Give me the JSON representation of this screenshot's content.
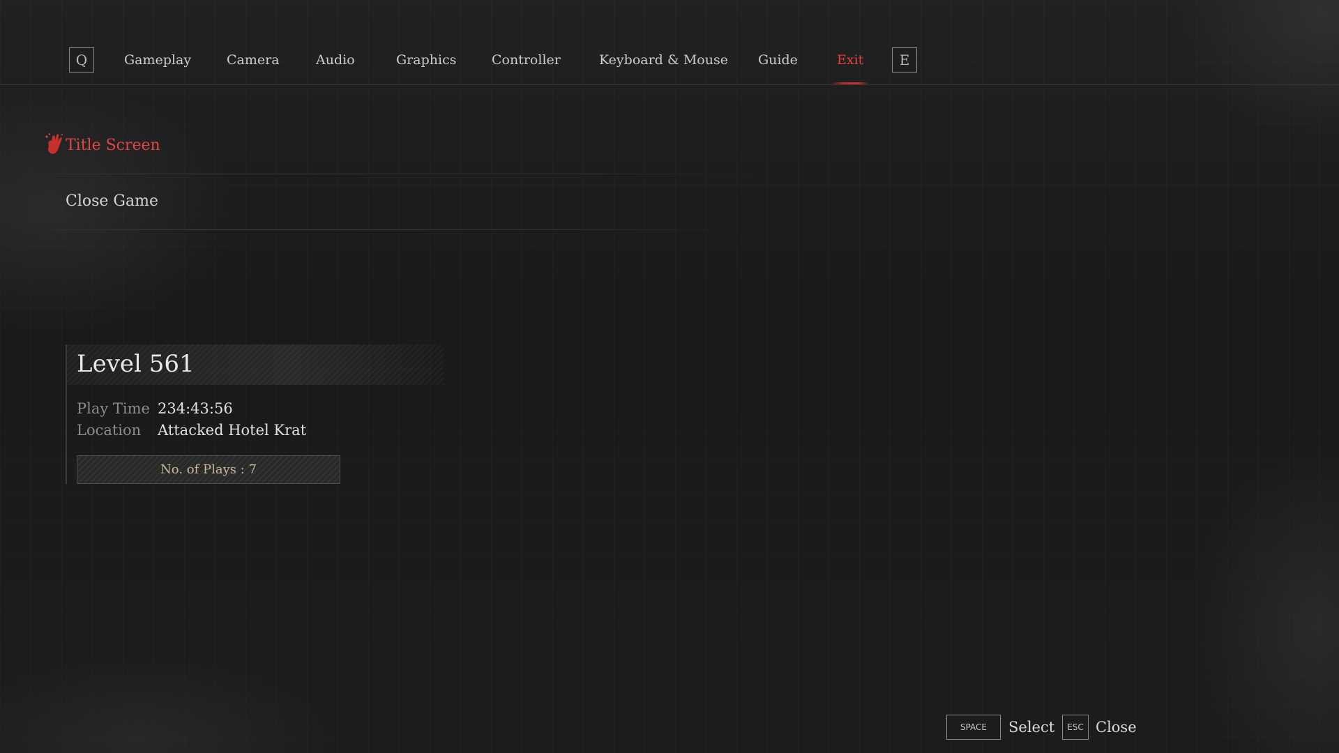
{
  "nav": {
    "prev_key": "Q",
    "next_key": "E",
    "tabs": [
      {
        "label": "Gameplay"
      },
      {
        "label": "Camera"
      },
      {
        "label": "Audio"
      },
      {
        "label": "Graphics"
      },
      {
        "label": "Controller"
      },
      {
        "label": "Keyboard & Mouse"
      },
      {
        "label": "Guide"
      },
      {
        "label": "Exit"
      }
    ],
    "active_tab": "Exit"
  },
  "exit_menu": {
    "items": [
      {
        "label": "Title Screen",
        "selected": true,
        "icon": "hand-icon"
      },
      {
        "label": "Close Game",
        "selected": false
      }
    ]
  },
  "save_info": {
    "level": "Level 561",
    "play_time_label": "Play Time",
    "play_time": "234:43:56",
    "location_label": "Location",
    "location": "Attacked Hotel Krat",
    "plays": "No. of Plays : 7"
  },
  "footer": {
    "select_key": "SPACE",
    "select_label": "Select",
    "close_key": "ESC",
    "close_label": "Close"
  },
  "colors": {
    "accent": "#e0413d",
    "background": "#1b1b1c",
    "text": "#d9d6d2"
  }
}
